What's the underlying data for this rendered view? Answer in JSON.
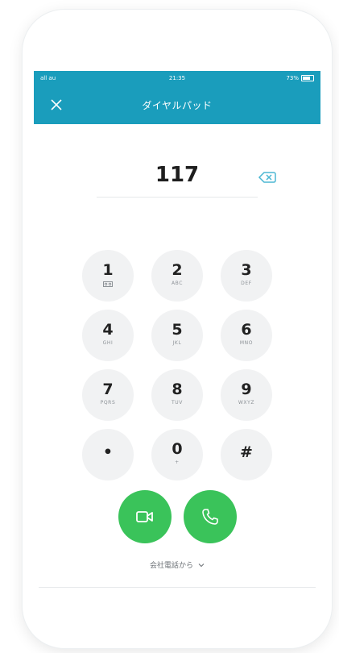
{
  "statusbar": {
    "carrier": "all au",
    "time": "21:35",
    "battery": "73%"
  },
  "header": {
    "title": "ダイヤルパッド",
    "close_icon": "close-icon"
  },
  "dial": {
    "number": "117",
    "backspace_icon": "backspace-icon"
  },
  "keypad": {
    "keys": [
      {
        "digit": "1",
        "letters": ""
      },
      {
        "digit": "2",
        "letters": "ABC"
      },
      {
        "digit": "3",
        "letters": "DEF"
      },
      {
        "digit": "4",
        "letters": "GHI"
      },
      {
        "digit": "5",
        "letters": "JKL"
      },
      {
        "digit": "6",
        "letters": "MNO"
      },
      {
        "digit": "7",
        "letters": "PQRS"
      },
      {
        "digit": "8",
        "letters": "TUV"
      },
      {
        "digit": "9",
        "letters": "WXYZ"
      },
      {
        "digit": "•",
        "letters": ""
      },
      {
        "digit": "0",
        "letters": "+"
      },
      {
        "digit": "#",
        "letters": ""
      }
    ]
  },
  "actions": {
    "video_call_icon": "video-camera-icon",
    "voice_call_icon": "phone-icon",
    "caller_label": "会社電話から"
  },
  "colors": {
    "header_bg": "#1a9dbc",
    "call_green": "#3ac35a",
    "key_bg": "#f1f2f3"
  }
}
